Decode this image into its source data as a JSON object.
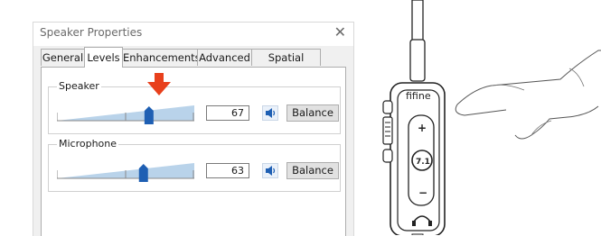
{
  "dialog": {
    "title": "Speaker Properties",
    "close_glyph": "✕",
    "tabs": [
      {
        "label": "General",
        "active": false
      },
      {
        "label": "Levels",
        "active": true
      },
      {
        "label": "Enhancements",
        "active": false
      },
      {
        "label": "Advanced",
        "active": false
      },
      {
        "label": "Spatial sound",
        "active": false
      }
    ],
    "speaker": {
      "label": "Speaker",
      "value": "67",
      "level": 0.67,
      "balance_label": "Balance",
      "icon": "speaker-icon"
    },
    "microphone": {
      "label": "Microphone",
      "value": "63",
      "level": 0.63,
      "balance_label": "Balance",
      "icon": "speaker-icon"
    },
    "arrow_color": "#e8401c"
  },
  "device": {
    "brand": "fifine",
    "center_label": "7.1",
    "plus": "+",
    "minus": "−"
  },
  "colors": {
    "slider_fill": "#b9d3ea",
    "thumb": "#1e5fb3",
    "accent": "#e8401c"
  }
}
